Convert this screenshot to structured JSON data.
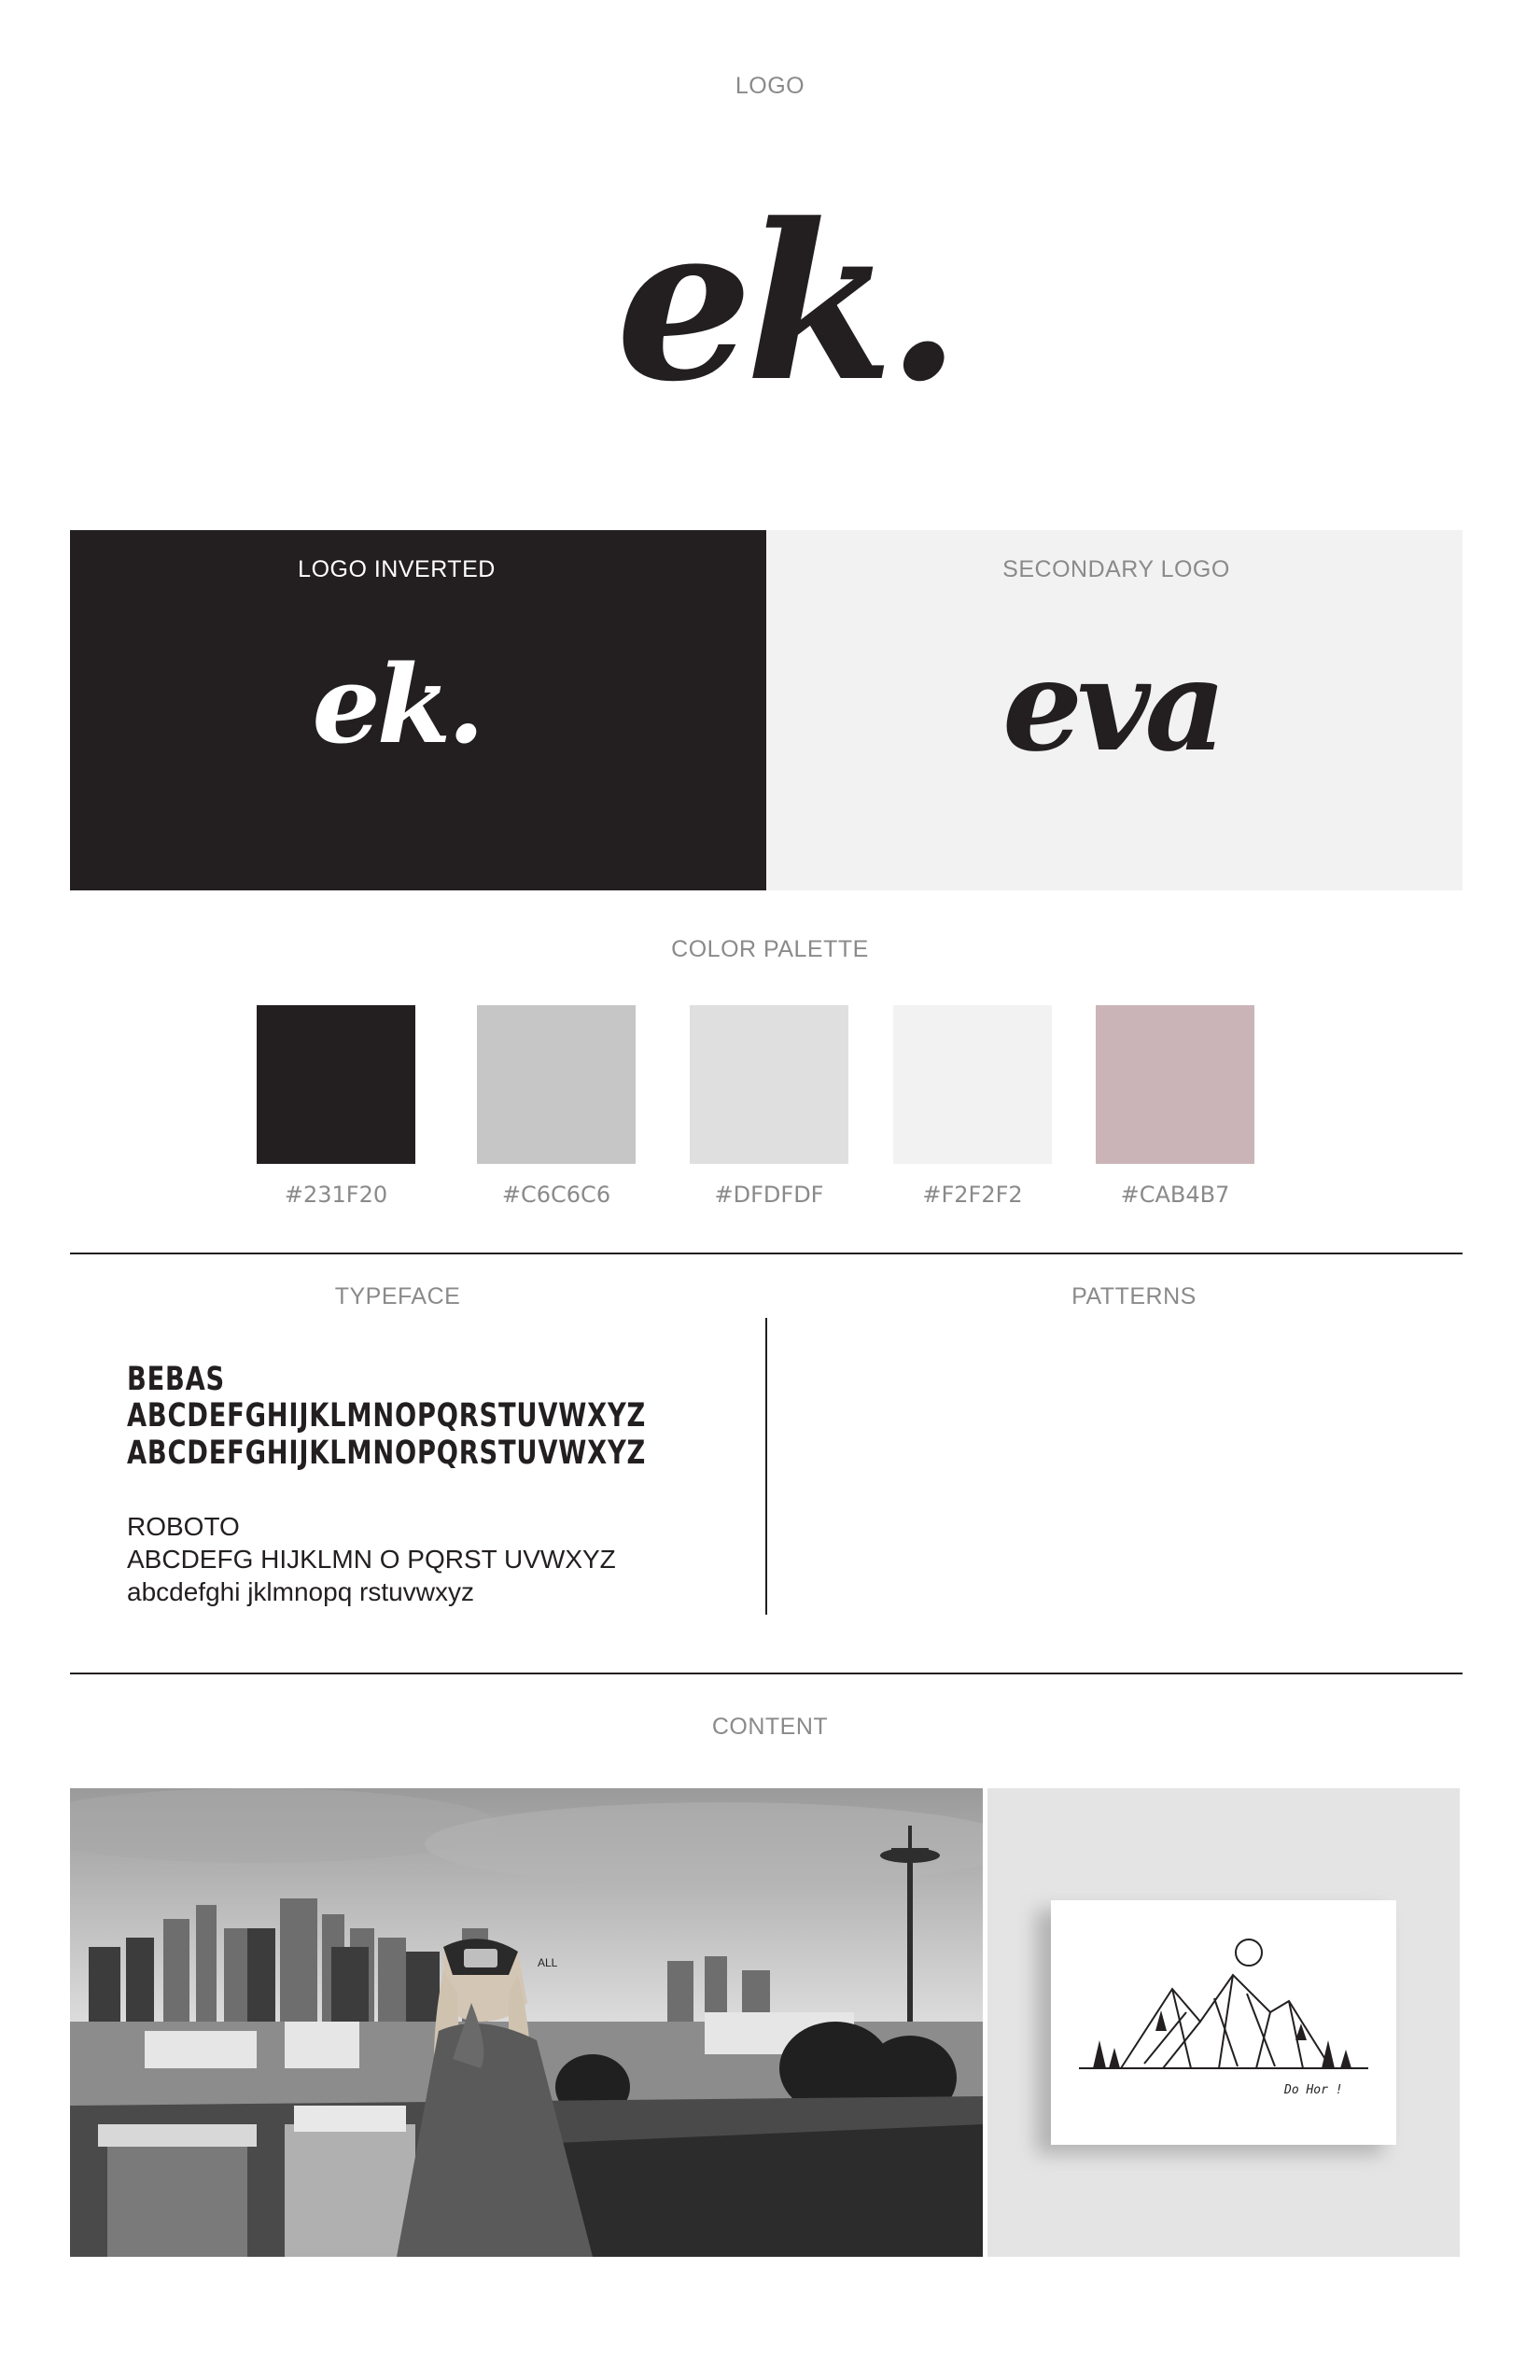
{
  "logo": {
    "label": "LOGO",
    "mark": "ek."
  },
  "logo_inverted": {
    "label": "LOGO INVERTED",
    "mark": "ek."
  },
  "secondary_logo": {
    "label": "SECONDARY LOGO",
    "mark": "eva"
  },
  "color_palette": {
    "label": "COLOR PALETTE",
    "swatches": [
      {
        "hex": "#231F20",
        "color": "#231f20"
      },
      {
        "hex": "#C6C6C6",
        "color": "#c6c6c6"
      },
      {
        "hex": "#DFDFDF",
        "color": "#dfdfdf"
      },
      {
        "hex": "#F2F2F2",
        "color": "#f2f2f2"
      },
      {
        "hex": "#CAB4B7",
        "color": "#cab4b7"
      }
    ]
  },
  "typeface": {
    "label": "TYPEFACE",
    "bebas_name": "BEBAS",
    "bebas_upper": "ABCDEFGHIJKLMNOPQRSTUVWXYZ",
    "bebas_upper_2": "ABCDEFGHIJKLMNOPQRSTUVWXYZ",
    "roboto_name": "ROBOTO",
    "roboto_upper": "ABCDEFG HIJKLMN O PQRST UVWXYZ",
    "roboto_lower": "abcdefghi jklmnopq rstuvwxyz"
  },
  "patterns": {
    "label": "PATTERNS"
  },
  "content": {
    "label": "CONTENT",
    "photo_cap_text": "ALL",
    "card_caption": "Do Hor !"
  }
}
